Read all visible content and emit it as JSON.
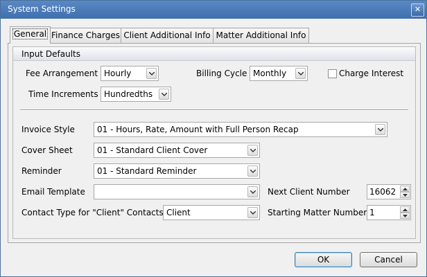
{
  "window": {
    "title": "System Settings",
    "close_glyph": "✕"
  },
  "tabs": [
    {
      "label": "General",
      "active": true
    },
    {
      "label": "Finance Charges",
      "active": false
    },
    {
      "label": "Client Additional Info",
      "active": false
    },
    {
      "label": "Matter Additional Info",
      "active": false
    }
  ],
  "input_defaults": {
    "title": "Input Defaults",
    "fee_arrangement": {
      "label": "Fee Arrangement",
      "value": "Hourly"
    },
    "billing_cycle": {
      "label": "Billing Cycle",
      "value": "Monthly"
    },
    "charge_interest": {
      "label": "Charge Interest",
      "checked": false
    },
    "time_increments": {
      "label": "Time Increments",
      "value": "Hundredths"
    },
    "invoice_style": {
      "label": "Invoice Style",
      "value": "01 - Hours, Rate, Amount with Full Person Recap"
    },
    "cover_sheet": {
      "label": "Cover Sheet",
      "value": "01 - Standard Client Cover"
    },
    "reminder": {
      "label": "Reminder",
      "value": "01 - Standard Reminder"
    },
    "email_template": {
      "label": "Email Template",
      "value": ""
    },
    "contact_type": {
      "label": "Contact Type for \"Client\" Contacts",
      "value": "Client"
    },
    "next_client_number": {
      "label": "Next Client Number",
      "value": "16062"
    },
    "starting_matter_number": {
      "label": "Starting Matter Number",
      "value": "1"
    }
  },
  "buttons": {
    "ok": "OK",
    "cancel": "Cancel"
  },
  "icons": {
    "dropdown": "chevron-down-icon",
    "spin": "spin-arrows-icon"
  }
}
